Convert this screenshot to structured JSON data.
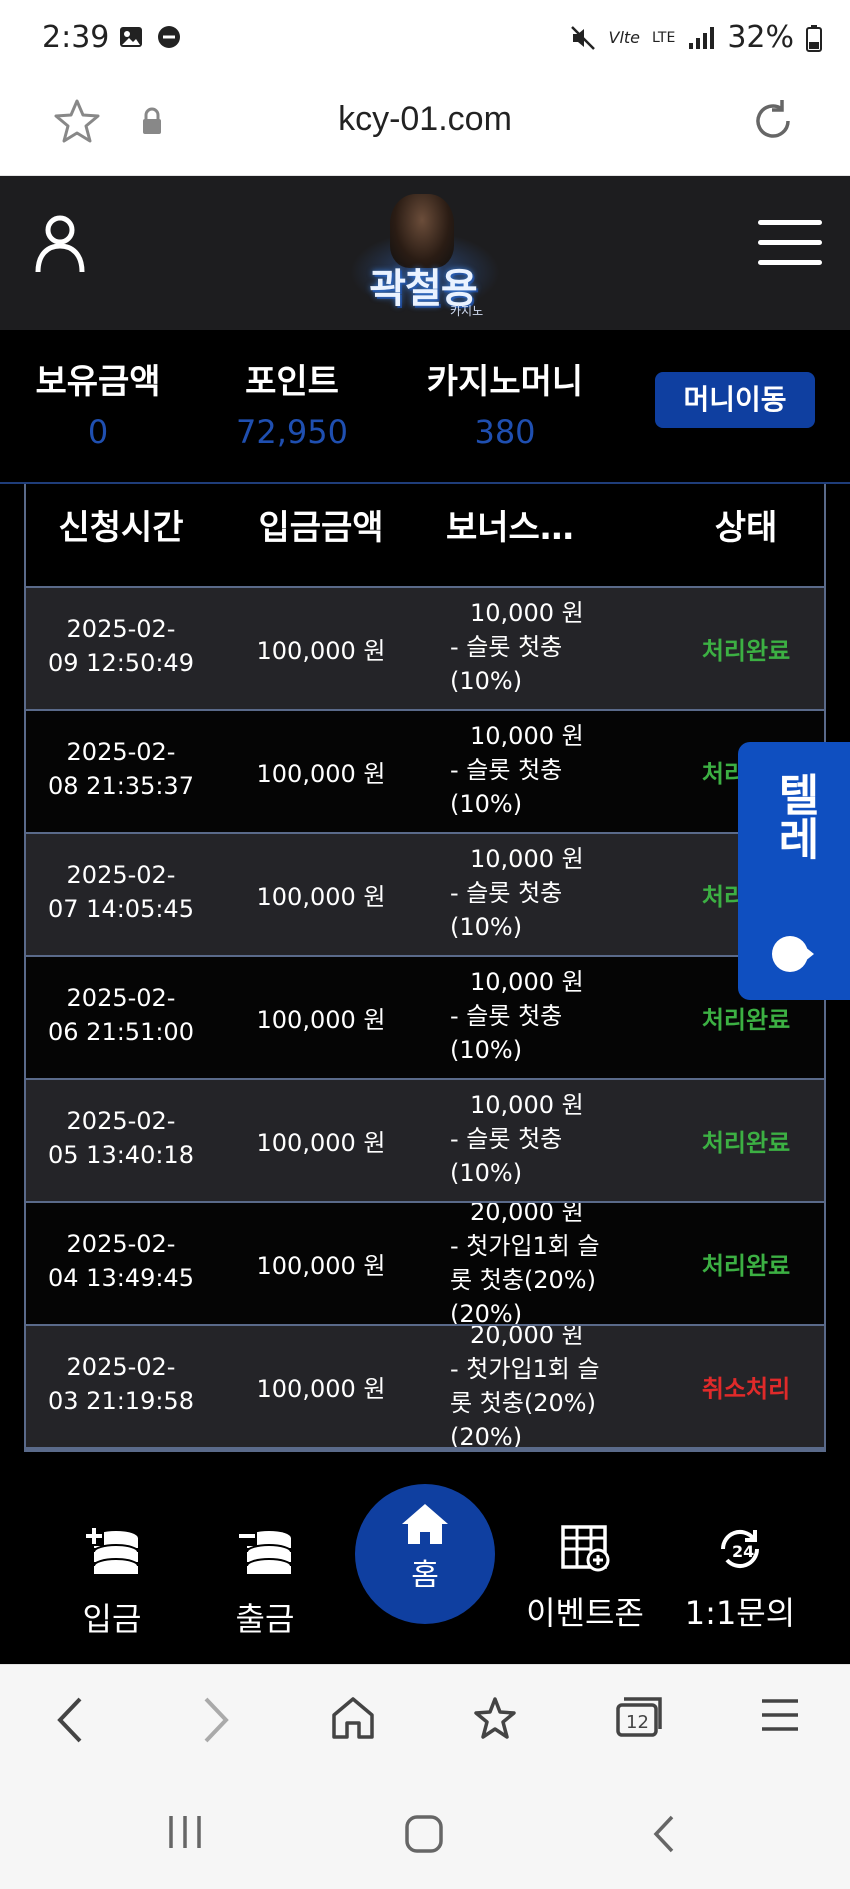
{
  "status_bar": {
    "time": "2:39",
    "network": "LTE",
    "battery": "32%"
  },
  "address_bar": {
    "url": "kcy-01.com"
  },
  "site": {
    "logo_title": "곽철용",
    "logo_sub": "카지노"
  },
  "balance": {
    "holding_label": "보유금액",
    "holding_value": "0",
    "point_label": "포인트",
    "point_value": "72,950",
    "casino_label": "카지노머니",
    "casino_value": "380",
    "move_button": "머니이동"
  },
  "table": {
    "headers": [
      "신청시간",
      "입금금액",
      "보너스…",
      "상태"
    ],
    "rows": [
      {
        "date": "2025-02-",
        "time": "09 12:50:49",
        "amount": "100,000 원",
        "bonus": [
          "10,000 원",
          "- 슬롯 첫충",
          "(10%)"
        ],
        "status": "처리완료",
        "status_color": "#3cb043"
      },
      {
        "date": "2025-02-",
        "time": "08 21:35:37",
        "amount": "100,000 원",
        "bonus": [
          "10,000 원",
          "- 슬롯 첫충",
          "(10%)"
        ],
        "status": "처리완료",
        "status_color": "#3cb043"
      },
      {
        "date": "2025-02-",
        "time": "07 14:05:45",
        "amount": "100,000 원",
        "bonus": [
          "10,000 원",
          "- 슬롯 첫충",
          "(10%)"
        ],
        "status": "처리완료",
        "status_color": "#3cb043"
      },
      {
        "date": "2025-02-",
        "time": "06 21:51:00",
        "amount": "100,000 원",
        "bonus": [
          "10,000 원",
          "- 슬롯 첫충",
          "(10%)"
        ],
        "status": "처리완료",
        "status_color": "#3cb043"
      },
      {
        "date": "2025-02-",
        "time": "05 13:40:18",
        "amount": "100,000 원",
        "bonus": [
          "10,000 원",
          "- 슬롯 첫충",
          "(10%)"
        ],
        "status": "처리완료",
        "status_color": "#3cb043"
      },
      {
        "date": "2025-02-",
        "time": "04 13:49:45",
        "amount": "100,000 원",
        "bonus": [
          "20,000 원",
          "- 첫가입1회 슬",
          "롯 첫충(20%)",
          "(20%)"
        ],
        "status": "처리완료",
        "status_color": "#3cb043"
      },
      {
        "date": "2025-02-",
        "time": "03 21:19:58",
        "amount": "100,000 원",
        "bonus": [
          "20,000 원",
          "- 첫가입1회 슬",
          "롯 첫충(20%)",
          "(20%)"
        ],
        "status": "취소처리",
        "status_color": "#e02a2a"
      }
    ]
  },
  "side_tab": {
    "label": "텔레"
  },
  "bottom_nav": {
    "deposit": "입금",
    "withdraw": "출금",
    "home": "홈",
    "event": "이벤트존",
    "inquiry": "1:1문의"
  },
  "colors": {
    "accent": "#0f3fa0",
    "side_tab": "#0f4fc0",
    "success": "#3cb043",
    "cancel": "#e02a2a"
  },
  "icons": [
    "star-icon",
    "lock-icon",
    "reload-icon",
    "user-icon",
    "menu-icon",
    "deposit-icon",
    "withdraw-icon",
    "home-icon",
    "event-icon",
    "support-24-icon",
    "back-icon",
    "forward-icon",
    "browser-home-icon",
    "bookmark-star-icon",
    "tabs-icon",
    "browser-menu-icon",
    "recents-icon",
    "sys-home-icon",
    "sys-back-icon"
  ]
}
